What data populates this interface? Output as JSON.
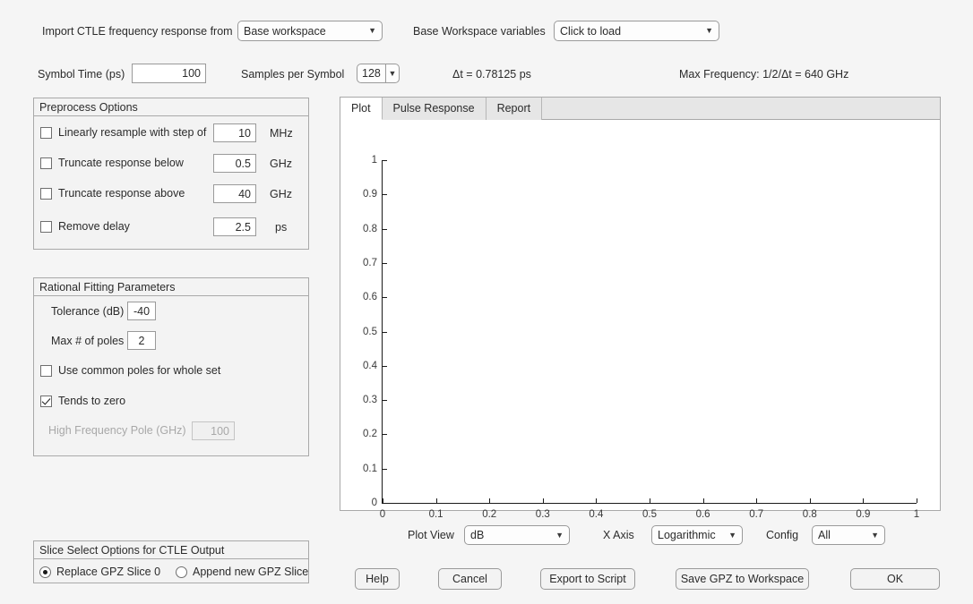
{
  "top": {
    "import_label": "Import CTLE frequency response from",
    "import_source": "Base workspace",
    "workspace_vars_label": "Base Workspace variables",
    "workspace_vars_value": "Click to load",
    "symbol_time_label": "Symbol Time (ps)",
    "symbol_time_value": "100",
    "samples_label": "Samples per Symbol",
    "samples_value": "128",
    "dt_text": "Δt = 0.78125 ps",
    "max_freq_text": "Max Frequency: 1/2/Δt = 640 GHz"
  },
  "preprocess": {
    "title": "Preprocess Options",
    "rows": [
      {
        "label": "Linearly resample with step of",
        "checked": false,
        "value": "10",
        "unit": "MHz"
      },
      {
        "label": "Truncate response below",
        "checked": false,
        "value": "0.5",
        "unit": "GHz"
      },
      {
        "label": "Truncate response above",
        "checked": false,
        "value": "40",
        "unit": "GHz"
      },
      {
        "label": "Remove delay",
        "checked": false,
        "value": "2.5",
        "unit": "ps"
      }
    ]
  },
  "rational": {
    "title": "Rational Fitting Parameters",
    "tolerance_label": "Tolerance (dB)",
    "tolerance_value": "-40",
    "maxpoles_label": "Max # of poles",
    "maxpoles_value": "2",
    "common_poles_label": "Use common poles for whole set",
    "common_poles_checked": false,
    "tends_zero_label": "Tends to zero",
    "tends_zero_checked": true,
    "hfpole_label": "High Frequency Pole (GHz)",
    "hfpole_value": "100",
    "hfpole_disabled": true
  },
  "slice": {
    "title": "Slice Select Options for CTLE Output",
    "options": [
      {
        "label": "Replace GPZ Slice 0",
        "selected": true
      },
      {
        "label": "Append new GPZ Slice",
        "selected": false
      }
    ]
  },
  "tabs": [
    {
      "label": "Plot",
      "active": true
    },
    {
      "label": "Pulse Response",
      "active": false
    },
    {
      "label": "Report",
      "active": false
    }
  ],
  "chart_data": {
    "type": "line",
    "title": "",
    "xlabel": "",
    "ylabel": "",
    "xlim": [
      0,
      1
    ],
    "ylim": [
      0,
      1
    ],
    "xticks": [
      "0",
      "0.1",
      "0.2",
      "0.3",
      "0.4",
      "0.5",
      "0.6",
      "0.7",
      "0.8",
      "0.9",
      "1"
    ],
    "yticks": [
      "0",
      "0.1",
      "0.2",
      "0.3",
      "0.4",
      "0.5",
      "0.6",
      "0.7",
      "0.8",
      "0.9",
      "1"
    ],
    "grid": false,
    "legend": null,
    "series": []
  },
  "plotcontrols": {
    "plotview_label": "Plot View",
    "plotview_value": "dB",
    "xaxis_label": "X Axis",
    "xaxis_value": "Logarithmic",
    "config_label": "Config",
    "config_value": "All"
  },
  "buttons": {
    "help": "Help",
    "cancel": "Cancel",
    "export": "Export to Script",
    "save": "Save GPZ to Workspace",
    "ok": "OK"
  }
}
